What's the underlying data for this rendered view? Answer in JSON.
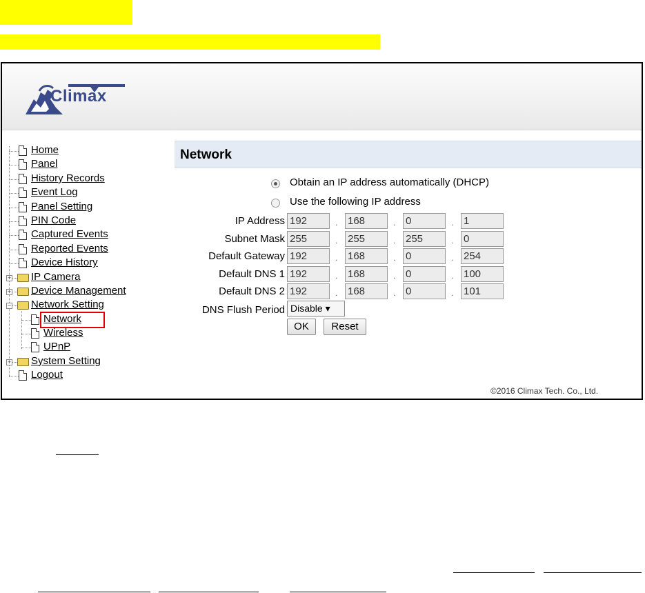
{
  "logo": {
    "text": "Climax"
  },
  "menu": [
    {
      "label": "Home",
      "kind": "doc",
      "level": 0
    },
    {
      "label": "Panel",
      "kind": "doc",
      "level": 0
    },
    {
      "label": "History Records",
      "kind": "doc",
      "level": 0
    },
    {
      "label": "Event Log",
      "kind": "doc",
      "level": 0
    },
    {
      "label": "Panel Setting",
      "kind": "doc",
      "level": 0
    },
    {
      "label": "PIN Code",
      "kind": "doc",
      "level": 0
    },
    {
      "label": "Captured Events",
      "kind": "doc",
      "level": 0
    },
    {
      "label": "Reported Events",
      "kind": "doc",
      "level": 0
    },
    {
      "label": "Device History",
      "kind": "doc",
      "level": 0
    },
    {
      "label": "IP Camera",
      "kind": "folder",
      "level": 0,
      "expander": "+"
    },
    {
      "label": "Device Management",
      "kind": "folder",
      "level": 0,
      "expander": "+"
    },
    {
      "label": "Network Setting",
      "kind": "folder-open",
      "level": 0,
      "expander": "−"
    },
    {
      "label": "Network",
      "kind": "doc",
      "level": 1,
      "selected": true
    },
    {
      "label": "Wireless",
      "kind": "doc",
      "level": 1
    },
    {
      "label": "UPnP",
      "kind": "doc",
      "level": 1
    },
    {
      "label": "System Setting",
      "kind": "folder",
      "level": 0,
      "expander": "+"
    },
    {
      "label": "Logout",
      "kind": "doc",
      "level": 0
    }
  ],
  "page": {
    "title": "Network"
  },
  "ip_mode": {
    "dhcp_label": "Obtain an IP address automatically (DHCP)",
    "static_label": "Use the following IP address",
    "selected": "dhcp"
  },
  "fields": [
    {
      "label": "IP Address",
      "octets": [
        "192",
        "168",
        "0",
        "1"
      ]
    },
    {
      "label": "Subnet Mask",
      "octets": [
        "255",
        "255",
        "255",
        "0"
      ]
    },
    {
      "label": "Default Gateway",
      "octets": [
        "192",
        "168",
        "0",
        "254"
      ]
    },
    {
      "label": "Default DNS 1",
      "octets": [
        "192",
        "168",
        "0",
        "100"
      ]
    },
    {
      "label": "Default DNS 2",
      "octets": [
        "192",
        "168",
        "0",
        "101"
      ]
    }
  ],
  "dns_flush": {
    "label": "DNS Flush Period",
    "value": "Disable ▾"
  },
  "buttons": {
    "ok": "OK",
    "reset": "Reset"
  },
  "footer": {
    "copyright": "©2016 Climax Tech. Co., Ltd."
  },
  "colors": {
    "highlight": "#ffff00",
    "selection": "#e00000",
    "title_bar": "#e4ebf5",
    "logo": "#3a4a8a"
  }
}
